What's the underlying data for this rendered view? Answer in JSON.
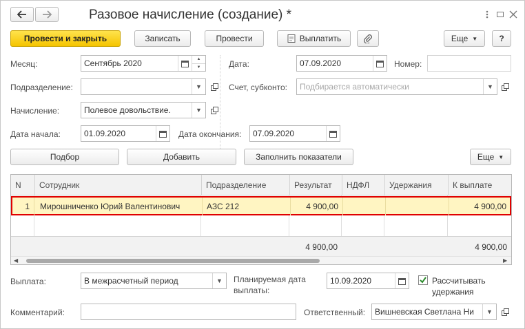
{
  "window": {
    "title": "Разовое начисление (создание) *"
  },
  "icons": {
    "back": "arrow-left-icon",
    "forward": "arrow-right-icon",
    "star": "star-icon",
    "more": "dots-vertical-icon",
    "maximize": "maximize-icon",
    "close": "close-icon",
    "calendar": "calendar-icon",
    "open": "open-form-icon",
    "paperclip": "paperclip-icon"
  },
  "toolbar": {
    "post_and_close": "Провести и закрыть",
    "save": "Записать",
    "post": "Провести",
    "pay": "Выплатить",
    "more": "Еще",
    "help": "?"
  },
  "form": {
    "month_label": "Месяц:",
    "month_value": "Сентябрь 2020",
    "date_label": "Дата:",
    "date_value": "07.09.2020",
    "number_label": "Номер:",
    "number_value": "",
    "division_label": "Подразделение:",
    "division_value": "",
    "account_label": "Счет, субконто:",
    "account_placeholder": "Подбирается автоматически",
    "accrual_label": "Начисление:",
    "accrual_value": "Полевое довольствие.",
    "start_label": "Дата начала:",
    "start_value": "01.09.2020",
    "end_label": "Дата окончания:",
    "end_value": "07.09.2020"
  },
  "table_toolbar": {
    "select": "Подбор",
    "add": "Добавить",
    "fill": "Заполнить показатели",
    "more": "Еще"
  },
  "table": {
    "columns": [
      "N",
      "Сотрудник",
      "Подразделение",
      "Результат",
      "НДФЛ",
      "Удержания",
      "К выплате"
    ],
    "rows": [
      {
        "n": "1",
        "employee": "Мирошниченко Юрий Валентинович",
        "division": "АЗС 212",
        "result": "4 900,00",
        "ndfl": "",
        "deductions": "",
        "to_pay": "4 900,00"
      }
    ],
    "totals": {
      "result": "4 900,00",
      "to_pay": "4 900,00"
    }
  },
  "bottom": {
    "payment_label": "Выплата:",
    "payment_value": "В межрасчетный период",
    "planned_label_line1": "Планируемая дата",
    "planned_label_line2": "выплаты:",
    "planned_value": "10.09.2020",
    "calc_label_line1": "Рассчитывать",
    "calc_label_line2": "удержания",
    "calc_checked": true,
    "comment_label": "Комментарий:",
    "comment_value": "",
    "responsible_label": "Ответственный:",
    "responsible_value": "Вишневская Светлана Ни"
  },
  "colors": {
    "primary_button": "#f5c400",
    "selected_row": "#fff5c2",
    "selection_border": "#e00000"
  }
}
